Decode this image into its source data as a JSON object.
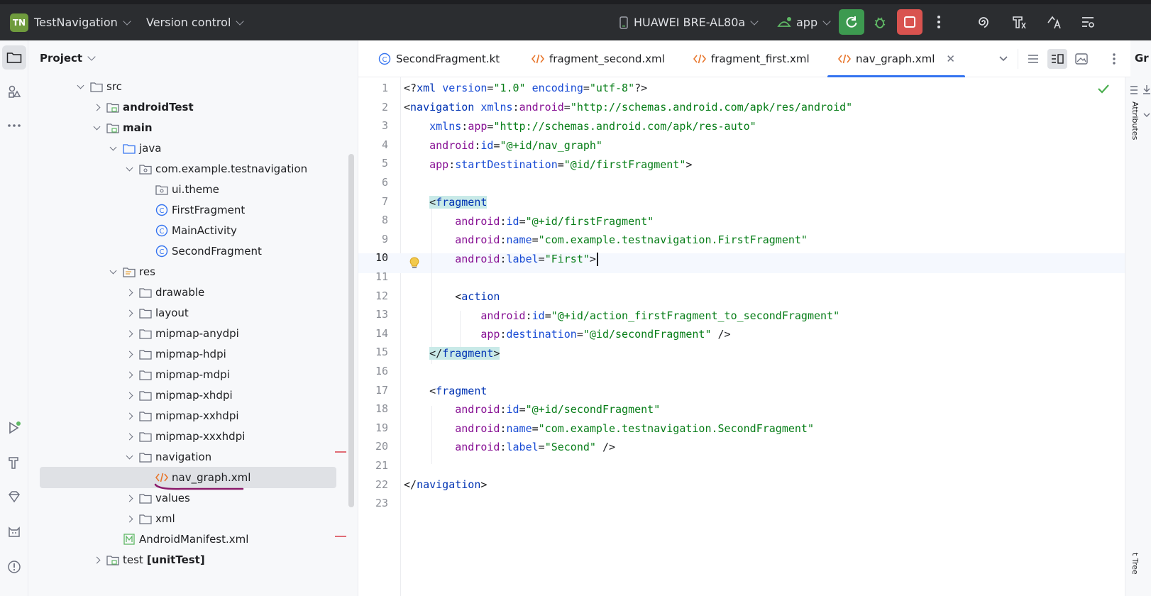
{
  "titlebar": {
    "project_badge": "TN",
    "project_name": "TestNavigation",
    "vcs": "Version control",
    "device": "HUAWEI BRE-AL80a",
    "run_config": "app"
  },
  "project_panel": {
    "title": "Project",
    "tree": [
      {
        "label": "src",
        "bold": false
      },
      {
        "label": "androidTest",
        "bold": true
      },
      {
        "label": "main",
        "bold": true
      },
      {
        "label": "java",
        "bold": false
      },
      {
        "label": "com.example.testnavigation",
        "bold": false
      },
      {
        "label": "ui.theme",
        "bold": false
      },
      {
        "label": "FirstFragment",
        "bold": false
      },
      {
        "label": "MainActivity",
        "bold": false
      },
      {
        "label": "SecondFragment",
        "bold": false
      },
      {
        "label": "res",
        "bold": false
      },
      {
        "label": "drawable",
        "bold": false
      },
      {
        "label": "layout",
        "bold": false
      },
      {
        "label": "mipmap-anydpi",
        "bold": false
      },
      {
        "label": "mipmap-hdpi",
        "bold": false
      },
      {
        "label": "mipmap-mdpi",
        "bold": false
      },
      {
        "label": "mipmap-xhdpi",
        "bold": false
      },
      {
        "label": "mipmap-xxhdpi",
        "bold": false
      },
      {
        "label": "mipmap-xxxhdpi",
        "bold": false
      },
      {
        "label": "navigation",
        "bold": false
      },
      {
        "label": "nav_graph.xml",
        "bold": false
      },
      {
        "label": "values",
        "bold": false
      },
      {
        "label": "xml",
        "bold": false
      },
      {
        "label": "AndroidManifest.xml",
        "bold": false
      },
      {
        "label": "test",
        "suffix": "[unitTest]"
      }
    ]
  },
  "tabs": [
    {
      "label": "SecondFragment.kt"
    },
    {
      "label": "fragment_second.xml"
    },
    {
      "label": "fragment_first.xml"
    },
    {
      "label": "nav_graph.xml",
      "active": true
    }
  ],
  "editor": {
    "current_line": 10,
    "line_numbers": [
      "1",
      "2",
      "3",
      "4",
      "5",
      "6",
      "7",
      "8",
      "9",
      "10",
      "11",
      "12",
      "13",
      "14",
      "15",
      "16",
      "17",
      "18",
      "19",
      "20",
      "21",
      "22",
      "23"
    ],
    "strings": {
      "xml_decl_open": "<?",
      "xml_kw": "xml",
      "version_attr": "version",
      "version_val": "\"1.0\"",
      "encoding_attr": "encoding",
      "encoding_val": "\"utf-8\"",
      "xml_decl_close": "?>",
      "lt": "<",
      "gt": ">",
      "lt_slash": "</",
      "self_close": " />",
      "eq": "=",
      "navigation": "navigation",
      "xmlns": "xmlns",
      "xmlns_android": "android",
      "xmlns_android_val": "\"http://schemas.android.com/apk/res/android\"",
      "xmlns_app": "app",
      "xmlns_app_val": "\"http://schemas.android.com/apk/res-auto\"",
      "android": "android",
      "app": "app",
      "id": "id",
      "name": "name",
      "label": "label",
      "startDestination": "startDestination",
      "destination": "destination",
      "nav_graph_id": "\"@+id/nav_graph\"",
      "start_dest_val": "\"@id/firstFragment\"",
      "fragment": "fragment",
      "action": "action",
      "first_id": "\"@+id/firstFragment\"",
      "first_name": "\"com.example.testnavigation.FirstFragment\"",
      "first_label": "\"First\"",
      "action_id": "\"@+id/action_firstFragment_to_secondFragment\"",
      "action_dest": "\"@id/secondFragment\"",
      "second_id": "\"@+id/secondFragment\"",
      "second_name": "\"com.example.testnavigation.SecondFragment\"",
      "second_label": "\"Second\""
    }
  },
  "right_strip": {
    "top_label": "Gr",
    "labels": [
      "Attributes",
      "t Tree"
    ]
  },
  "colors": {
    "titlebar_bg": "#2b2d30",
    "run_green": "#3d9a50",
    "stop_red": "#d9534f",
    "tag_blue": "#0033b3",
    "ns_purple": "#871094",
    "value_green": "#067d17",
    "accent": "#3574f0",
    "annotation_stroke": "#8b1a6b"
  }
}
